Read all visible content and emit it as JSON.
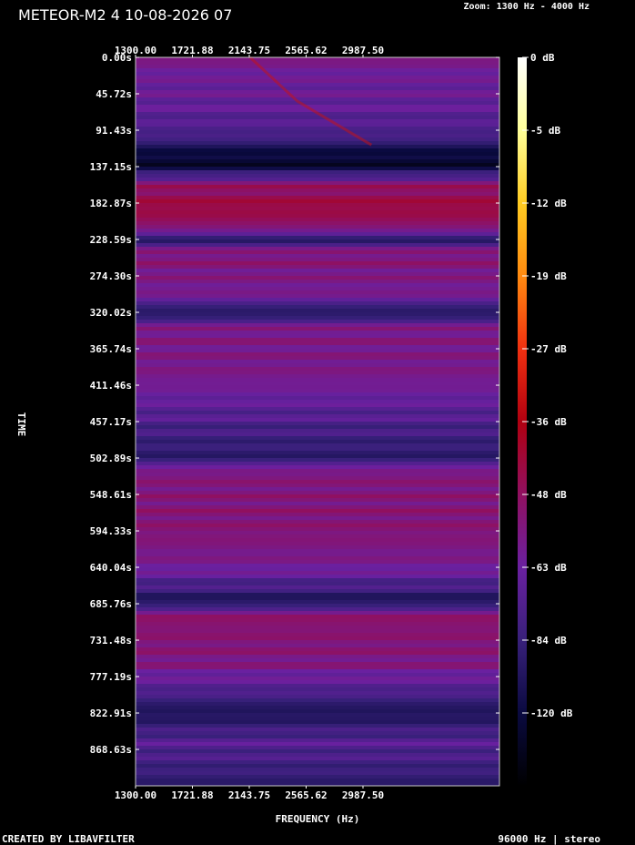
{
  "header": {
    "title": "METEOR-M2 4 10-08-2026 07",
    "zoom": "Zoom: 1300 Hz - 4000 Hz"
  },
  "footer": {
    "credit": "CREATED BY LIBAVFILTER",
    "format": "96000 Hz | stereo"
  },
  "chart_data": {
    "type": "heatmap",
    "title": "METEOR-M2 4 10-08-2026 07",
    "xlabel": "FREQUENCY (Hz)",
    "ylabel": "TIME",
    "x_ticks": [
      "1300.00",
      "1721.88",
      "2143.75",
      "2565.62",
      "2987.50"
    ],
    "x_tick_values": [
      1300.0,
      1721.88,
      2143.75,
      2565.62,
      2987.5
    ],
    "xlim": [
      1300,
      4000
    ],
    "y_ticks": [
      "0.00s",
      "45.72s",
      "91.43s",
      "137.15s",
      "182.87s",
      "228.59s",
      "274.30s",
      "320.02s",
      "365.74s",
      "411.46s",
      "457.17s",
      "502.89s",
      "548.61s",
      "594.33s",
      "640.04s",
      "685.76s",
      "731.48s",
      "777.19s",
      "822.91s",
      "868.63s"
    ],
    "y_tick_values": [
      0,
      45.72,
      91.43,
      137.15,
      182.87,
      228.59,
      274.3,
      320.02,
      365.74,
      411.46,
      457.17,
      502.89,
      548.61,
      594.33,
      640.04,
      685.76,
      731.48,
      777.19,
      822.91,
      868.63
    ],
    "ylim": [
      0,
      914.3
    ],
    "colorbar": {
      "labels": [
        "0 dB",
        "-5 dB",
        "-12 dB",
        "-19 dB",
        "-27 dB",
        "-36 dB",
        "-48 dB",
        "-63 dB",
        "-84 dB",
        "-120 dB"
      ],
      "stops": [
        "#ffffff",
        "#ffff99",
        "#ffcc22",
        "#ff8a10",
        "#f03010",
        "#b00010",
        "#901060",
        "#6a20a0",
        "#38207a",
        "#0a0a40",
        "#000000"
      ]
    },
    "band_profile_db": [
      {
        "t": 0,
        "db": -84
      },
      {
        "t": 20,
        "db": -90
      },
      {
        "t": 55,
        "db": -92
      },
      {
        "t": 100,
        "db": -100
      },
      {
        "t": 120,
        "db": -118
      },
      {
        "t": 137,
        "db": -120
      },
      {
        "t": 160,
        "db": -80
      },
      {
        "t": 190,
        "db": -72
      },
      {
        "t": 215,
        "db": -82
      },
      {
        "t": 228,
        "db": -110
      },
      {
        "t": 245,
        "db": -82
      },
      {
        "t": 300,
        "db": -88
      },
      {
        "t": 320,
        "db": -112
      },
      {
        "t": 340,
        "db": -85
      },
      {
        "t": 400,
        "db": -86
      },
      {
        "t": 502,
        "db": -108
      },
      {
        "t": 520,
        "db": -84
      },
      {
        "t": 594,
        "db": -82
      },
      {
        "t": 640,
        "db": -88
      },
      {
        "t": 685,
        "db": -112
      },
      {
        "t": 700,
        "db": -80
      },
      {
        "t": 760,
        "db": -84
      },
      {
        "t": 800,
        "db": -100
      },
      {
        "t": 822,
        "db": -112
      },
      {
        "t": 860,
        "db": -96
      },
      {
        "t": 914,
        "db": -108
      }
    ],
    "doppler_trace": {
      "points": [
        {
          "hz": 2150,
          "t": 0
        },
        {
          "hz": 2500,
          "t": 55
        },
        {
          "hz": 3050,
          "t": 110
        }
      ],
      "db": -60
    }
  }
}
